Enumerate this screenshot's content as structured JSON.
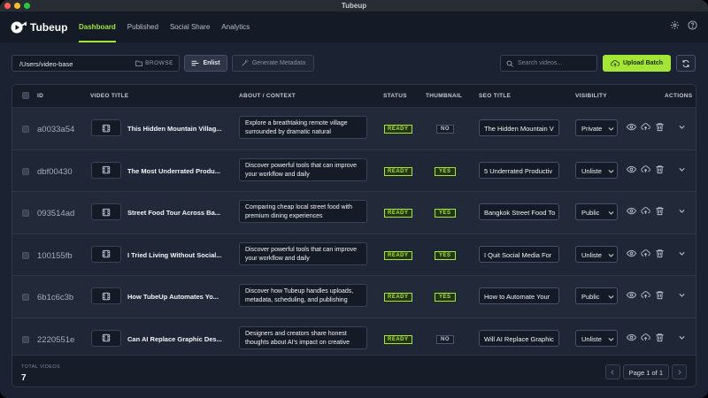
{
  "window": {
    "title": "Tubeup"
  },
  "colors": {
    "accent": "#a3e635",
    "close": "#ff5f57",
    "minimize": "#febc2e",
    "maximize": "#28c840"
  },
  "brand": {
    "name": "Tubeup"
  },
  "nav": {
    "tabs": [
      "Dashboard",
      "Published",
      "Social Share",
      "Analytics"
    ],
    "active": "Dashboard",
    "icons": [
      "gear-icon",
      "help-icon"
    ]
  },
  "toolbar": {
    "path_value": "/Users/video-base",
    "browse_label": "BROWSE",
    "enlist_label": "Enlist",
    "generate_label": "Generate Metadata",
    "search_placeholder": "Search videos...",
    "upload_label": "Upload Batch"
  },
  "table": {
    "headers": {
      "id": "ID",
      "video_title": "VIDEO TITLE",
      "about": "ABOUT / CONTEXT",
      "status": "STATUS",
      "thumbnail": "THUMBNAIL",
      "seo_title": "SEO TITLE",
      "visibility": "VISIBILITY",
      "actions": "ACTIONS"
    },
    "rows": [
      {
        "id": "a0033a54",
        "title": "This Hidden Mountain Villag...",
        "about": "Explore a breathtaking remote village surrounded by dramatic natural",
        "status": "READY",
        "thumbnail": "NO",
        "seo": "The Hidden Mountain V",
        "visibility": "Private"
      },
      {
        "id": "dbf00430",
        "title": "The Most Underrated Produ...",
        "about": "Discover powerful tools that can improve your workflow and daily",
        "status": "READY",
        "thumbnail": "YES",
        "seo": "5 Underrated Productiv",
        "visibility": "Unliste"
      },
      {
        "id": "093514ad",
        "title": "Street Food Tour Across Ba...",
        "about": "Comparing cheap local street food with premium dining experiences",
        "status": "READY",
        "thumbnail": "YES",
        "seo": "Bangkok Street Food To",
        "visibility": "Public"
      },
      {
        "id": "100155fb",
        "title": "I Tried Living Without Social...",
        "about": "Discover powerful tools that can improve your workflow and daily",
        "status": "READY",
        "thumbnail": "YES",
        "seo": "I Quit Social Media For",
        "visibility": "Unliste"
      },
      {
        "id": "6b1c6c3b",
        "title": "How TubeUp Automates Yo...",
        "about": "Discover how Tubeup handles uploads, metadata, scheduling, and publishing",
        "status": "READY",
        "thumbnail": "YES",
        "seo": "How to Automate Your",
        "visibility": "Public"
      },
      {
        "id": "2220551e",
        "title": "Can AI Replace Graphic Des...",
        "about": "Designers and creators share honest thoughts about AI's impact on creative",
        "status": "READY",
        "thumbnail": "NO",
        "seo": "Will AI Replace Graphic",
        "visibility": "Unliste"
      }
    ]
  },
  "footer": {
    "total_label": "TOTAL VIDEOS",
    "total_value": "7",
    "page_info": "Page 1 of 1"
  }
}
